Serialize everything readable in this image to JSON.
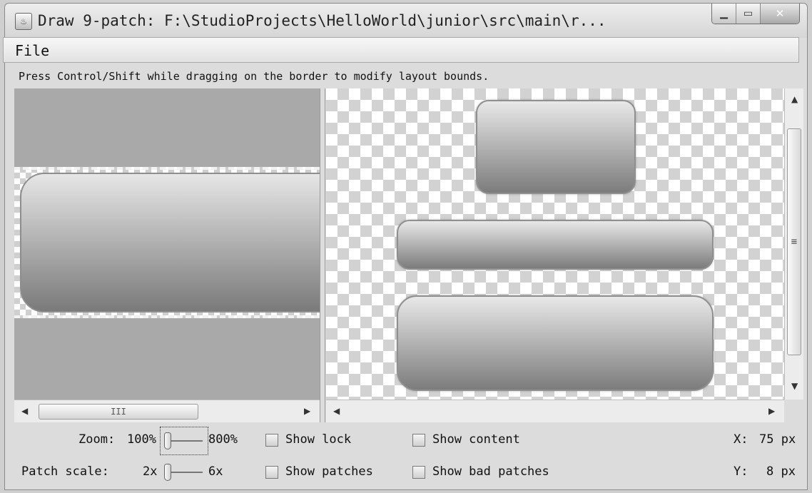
{
  "window": {
    "title": "Draw 9-patch: F:\\StudioProjects\\HelloWorld\\junior\\src\\main\\r...",
    "app_icon": "java-cup-icon"
  },
  "menu": {
    "file": "File"
  },
  "hint": "Press Control/Shift while dragging on the border to modify layout bounds.",
  "scroll": {
    "left_thumb_grip": "III"
  },
  "controls": {
    "zoom_label": "Zoom:",
    "zoom_min": "100%",
    "zoom_max": "800%",
    "zoom_value_fraction": 0.0,
    "patch_scale_label": "Patch scale:",
    "patch_min": "2x",
    "patch_max": "6x",
    "patch_value_fraction": 0.0,
    "show_lock": "Show lock",
    "show_patches": "Show patches",
    "show_content": "Show content",
    "show_bad_patches": "Show bad patches",
    "x_label": "X:",
    "x_value": "75 px",
    "y_label": "Y:",
    "y_value": "8 px"
  }
}
